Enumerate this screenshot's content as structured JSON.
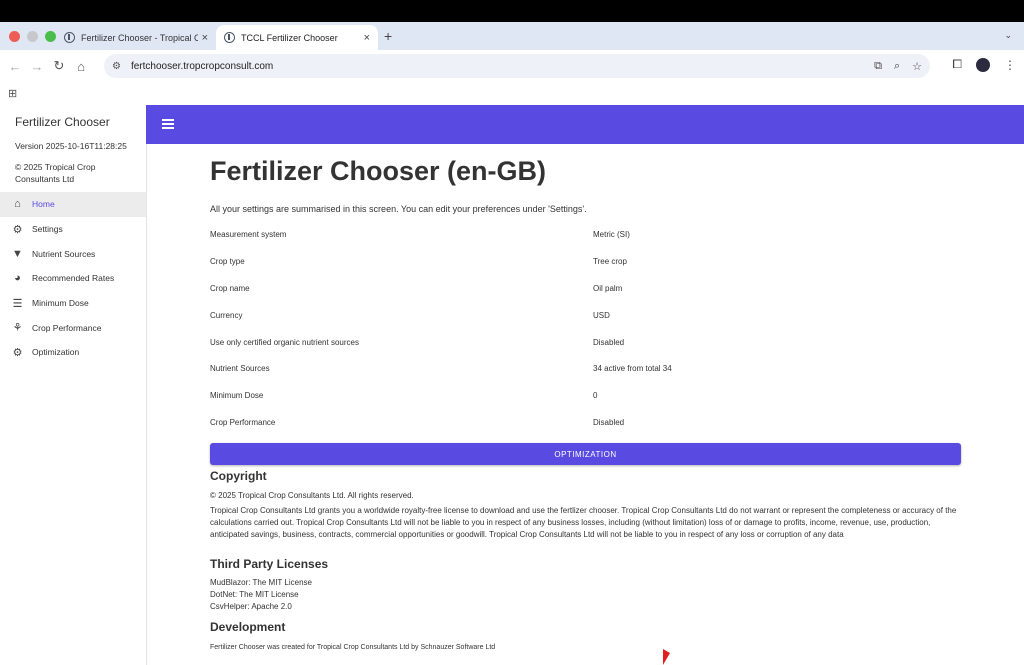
{
  "browser": {
    "tabs": [
      {
        "title": "Fertilizer Chooser - Tropical C",
        "close": "×"
      },
      {
        "title": "TCCL Fertilizer Chooser",
        "close": "×"
      }
    ],
    "new_tab": "+",
    "tab_dropdown": "⌄",
    "nav": {
      "back": "←",
      "forward": "→",
      "reload": "↻",
      "home": "⌂"
    },
    "site_icon": "⚙",
    "url": "fertchooser.tropcropconsult.com",
    "omnibox_icons": [
      "⧉",
      "⌕",
      "☆"
    ],
    "toolbar_icons": [
      "⧠",
      "⋮"
    ],
    "apps_icon": "⊞"
  },
  "sidebar": {
    "title": "Fertilizer Chooser",
    "version": "Version 2025-10-16T11:28:25",
    "copyright": "© 2025 Tropical Crop Consultants Ltd",
    "items": [
      {
        "label": "Home",
        "icon": "home-icon",
        "glyph": "⌂"
      },
      {
        "label": "Settings",
        "icon": "gear-icon",
        "glyph": "⚙"
      },
      {
        "label": "Nutrient Sources",
        "icon": "filter-icon",
        "glyph": "▼"
      },
      {
        "label": "Recommended Rates",
        "icon": "pie-chart-icon",
        "glyph": "◕"
      },
      {
        "label": "Minimum Dose",
        "icon": "checklist-icon",
        "glyph": "☰"
      },
      {
        "label": "Crop Performance",
        "icon": "crop-icon",
        "glyph": "⚘"
      },
      {
        "label": "Optimization",
        "icon": "tractor-icon",
        "glyph": "⚙"
      }
    ]
  },
  "colors": {
    "accent": "#594ae2"
  },
  "main": {
    "heading": "Fertilizer Chooser (en-GB)",
    "intro": "All your settings are summarised in this screen. You can edit your preferences under 'Settings'.",
    "summary": [
      {
        "key": "Measurement system",
        "value": "Metric (SI)"
      },
      {
        "key": "Crop type",
        "value": "Tree crop"
      },
      {
        "key": "Crop name",
        "value": "Oil palm"
      },
      {
        "key": "Currency",
        "value": "USD"
      },
      {
        "key": "Use only certified organic nutrient sources",
        "value": "Disabled"
      },
      {
        "key": "Nutrient Sources",
        "value": "34 active from total 34"
      },
      {
        "key": "Minimum Dose",
        "value": "0"
      },
      {
        "key": "Crop Performance",
        "value": "Disabled"
      }
    ],
    "optimization_button": "OPTIMIZATION",
    "copyright_heading": "Copyright",
    "copyright_line": "© 2025 Tropical Crop Consultants Ltd. All rights reserved.",
    "copyright_text": "Tropical Crop Consultants Ltd grants you a worldwide royalty-free license to download and use the fertlizer chooser. Tropical Crop Consultants Ltd do not warrant or represent the completeness or accuracy of the calculations carried out. Tropical Crop Consultants Ltd will not be liable to you in respect of any business losses, including (without limitation) loss of or damage to profits, income, revenue, use, production, anticipated savings, business, contracts, commercial opportunities or goodwill. Tropical Crop Consultants Ltd will not be liable to you in respect of any loss or corruption of any data",
    "licenses_heading": "Third Party Licenses",
    "licenses": [
      "MudBlazor: The MIT License",
      "DotNet: The MIT License",
      "CsvHelper: Apache 2.0"
    ],
    "development_heading": "Development",
    "development_text": "Fertilizer Chooser was created for Tropical Crop Consultants Ltd by Schnauzer Software Ltd"
  }
}
